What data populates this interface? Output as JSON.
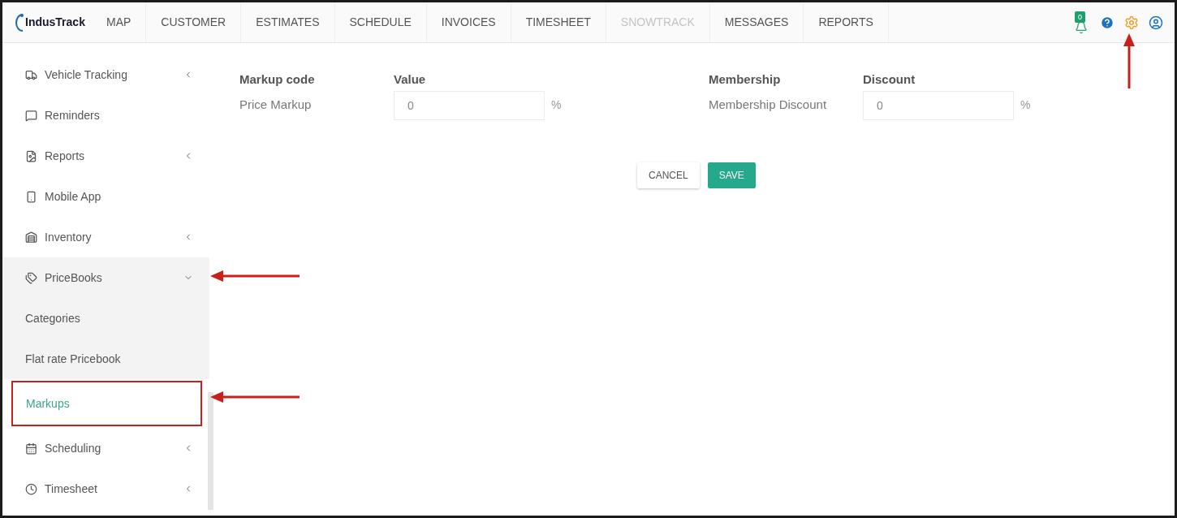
{
  "header": {
    "logo": "IndusTrack",
    "nav": [
      {
        "label": "MAP",
        "disabled": false
      },
      {
        "label": "CUSTOMER",
        "disabled": false
      },
      {
        "label": "ESTIMATES",
        "disabled": false
      },
      {
        "label": "SCHEDULE",
        "disabled": false
      },
      {
        "label": "INVOICES",
        "disabled": false
      },
      {
        "label": "TIMESHEET",
        "disabled": false
      },
      {
        "label": "SNOWTRACK",
        "disabled": true
      },
      {
        "label": "MESSAGES",
        "disabled": false
      },
      {
        "label": "REPORTS",
        "disabled": false
      }
    ],
    "notification_count": "0"
  },
  "sidebar": {
    "items": [
      {
        "label": "Vehicle Tracking",
        "expanded": false
      },
      {
        "label": "Reminders"
      },
      {
        "label": "Reports",
        "expanded": false
      },
      {
        "label": "Mobile App"
      },
      {
        "label": "Inventory",
        "expanded": false
      },
      {
        "label": "PriceBooks",
        "expanded": true,
        "children": [
          {
            "label": "Categories",
            "selected": false
          },
          {
            "label": "Flat rate Pricebook",
            "selected": false
          },
          {
            "label": "Markups",
            "selected": true,
            "highlighted": true
          }
        ]
      },
      {
        "label": "Scheduling",
        "expanded": false
      },
      {
        "label": "Timesheet",
        "expanded": false
      }
    ]
  },
  "form": {
    "groups": [
      {
        "heading_name": "Markup code",
        "heading_value": "Value",
        "name": "Price Markup",
        "value": "0",
        "unit": "%"
      },
      {
        "heading_name": "Membership",
        "heading_value": "Discount",
        "name": "Membership Discount",
        "value": "0",
        "unit": "%"
      }
    ],
    "buttons": [
      {
        "label": "CANCEL",
        "kind": "secondary"
      },
      {
        "label": "SAVE",
        "kind": "primary"
      }
    ]
  }
}
